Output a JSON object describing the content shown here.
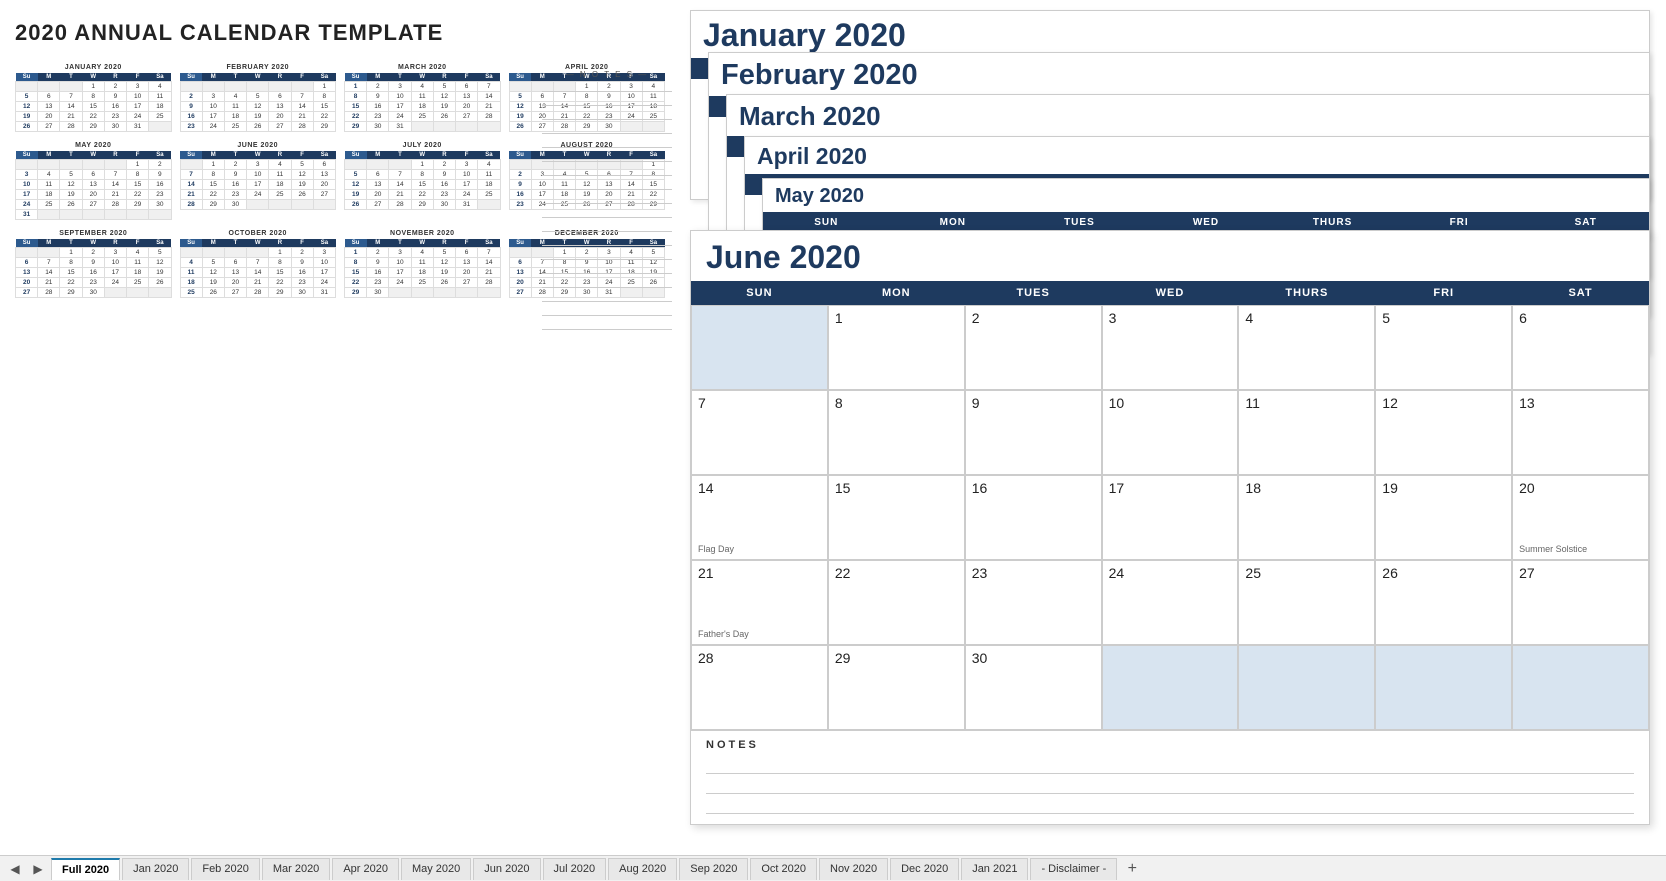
{
  "title": "2020 ANNUAL CALENDAR TEMPLATE",
  "annualCalendar": {
    "months": [
      {
        "name": "JANUARY 2020",
        "headers": [
          "Su",
          "M",
          "T",
          "W",
          "R",
          "F",
          "Sa"
        ],
        "weeks": [
          [
            "",
            "",
            "",
            "1",
            "2",
            "3",
            "4"
          ],
          [
            "5",
            "6",
            "7",
            "8",
            "9",
            "10",
            "11"
          ],
          [
            "12",
            "13",
            "14",
            "15",
            "16",
            "17",
            "18"
          ],
          [
            "19",
            "20",
            "21",
            "22",
            "23",
            "24",
            "25"
          ],
          [
            "26",
            "27",
            "28",
            "29",
            "30",
            "31",
            ""
          ]
        ]
      },
      {
        "name": "FEBRUARY 2020",
        "headers": [
          "Su",
          "M",
          "T",
          "W",
          "R",
          "F",
          "Sa"
        ],
        "weeks": [
          [
            "",
            "",
            "",
            "",
            "",
            "",
            "1"
          ],
          [
            "2",
            "3",
            "4",
            "5",
            "6",
            "7",
            "8"
          ],
          [
            "9",
            "10",
            "11",
            "12",
            "13",
            "14",
            "15"
          ],
          [
            "16",
            "17",
            "18",
            "19",
            "20",
            "21",
            "22"
          ],
          [
            "23",
            "24",
            "25",
            "26",
            "27",
            "28",
            "29"
          ]
        ]
      },
      {
        "name": "MARCH 2020",
        "headers": [
          "Su",
          "M",
          "T",
          "W",
          "R",
          "F",
          "Sa"
        ],
        "weeks": [
          [
            "1",
            "2",
            "3",
            "4",
            "5",
            "6",
            "7"
          ],
          [
            "8",
            "9",
            "10",
            "11",
            "12",
            "13",
            "14"
          ],
          [
            "15",
            "16",
            "17",
            "18",
            "19",
            "20",
            "21"
          ],
          [
            "22",
            "23",
            "24",
            "25",
            "26",
            "27",
            "28"
          ],
          [
            "29",
            "30",
            "31",
            "",
            "",
            "",
            ""
          ]
        ]
      },
      {
        "name": "APRIL 2020",
        "headers": [
          "Su",
          "M",
          "T",
          "W",
          "R",
          "F",
          "Sa"
        ],
        "weeks": [
          [
            "",
            "",
            "",
            "1",
            "2",
            "3",
            "4"
          ],
          [
            "5",
            "6",
            "7",
            "8",
            "9",
            "10",
            "11"
          ],
          [
            "12",
            "13",
            "14",
            "15",
            "16",
            "17",
            "18"
          ],
          [
            "19",
            "20",
            "21",
            "22",
            "23",
            "24",
            "25"
          ],
          [
            "26",
            "27",
            "28",
            "29",
            "30",
            "",
            ""
          ]
        ]
      },
      {
        "name": "MAY 2020",
        "headers": [
          "Su",
          "M",
          "T",
          "W",
          "R",
          "F",
          "Sa"
        ],
        "weeks": [
          [
            "",
            "",
            "",
            "",
            "",
            "1",
            "2"
          ],
          [
            "3",
            "4",
            "5",
            "6",
            "7",
            "8",
            "9"
          ],
          [
            "10",
            "11",
            "12",
            "13",
            "14",
            "15",
            "16"
          ],
          [
            "17",
            "18",
            "19",
            "20",
            "21",
            "22",
            "23"
          ],
          [
            "24",
            "25",
            "26",
            "27",
            "28",
            "29",
            "30"
          ],
          [
            "31",
            "",
            "",
            "",
            "",
            "",
            ""
          ]
        ]
      },
      {
        "name": "JUNE 2020",
        "headers": [
          "Su",
          "M",
          "T",
          "W",
          "R",
          "F",
          "Sa"
        ],
        "weeks": [
          [
            "",
            "1",
            "2",
            "3",
            "4",
            "5",
            "6"
          ],
          [
            "7",
            "8",
            "9",
            "10",
            "11",
            "12",
            "13"
          ],
          [
            "14",
            "15",
            "16",
            "17",
            "18",
            "19",
            "20"
          ],
          [
            "21",
            "22",
            "23",
            "24",
            "25",
            "26",
            "27"
          ],
          [
            "28",
            "29",
            "30",
            "",
            "",
            "",
            ""
          ]
        ]
      },
      {
        "name": "JULY 2020",
        "headers": [
          "Su",
          "M",
          "T",
          "W",
          "R",
          "F",
          "Sa"
        ],
        "weeks": [
          [
            "",
            "",
            "",
            "1",
            "2",
            "3",
            "4"
          ],
          [
            "5",
            "6",
            "7",
            "8",
            "9",
            "10",
            "11"
          ],
          [
            "12",
            "13",
            "14",
            "15",
            "16",
            "17",
            "18"
          ],
          [
            "19",
            "20",
            "21",
            "22",
            "23",
            "24",
            "25"
          ],
          [
            "26",
            "27",
            "28",
            "29",
            "30",
            "31",
            ""
          ]
        ]
      },
      {
        "name": "AUGUST 2020",
        "headers": [
          "Su",
          "M",
          "T",
          "W",
          "R",
          "F",
          "Sa"
        ],
        "weeks": [
          [
            "",
            "",
            "",
            "",
            "",
            "",
            "1"
          ],
          [
            "2",
            "3",
            "4",
            "5",
            "6",
            "7",
            "8"
          ],
          [
            "9",
            "10",
            "11",
            "12",
            "13",
            "14",
            "15"
          ],
          [
            "16",
            "17",
            "18",
            "19",
            "20",
            "21",
            "22"
          ],
          [
            "23",
            "24",
            "25",
            "26",
            "27",
            "28",
            "29"
          ]
        ]
      },
      {
        "name": "SEPTEMBER 2020",
        "headers": [
          "Su",
          "M",
          "T",
          "W",
          "R",
          "F",
          "Sa"
        ],
        "weeks": [
          [
            "",
            "",
            "1",
            "2",
            "3",
            "4",
            "5"
          ],
          [
            "6",
            "7",
            "8",
            "9",
            "10",
            "11",
            "12"
          ],
          [
            "13",
            "14",
            "15",
            "16",
            "17",
            "18",
            "19"
          ],
          [
            "20",
            "21",
            "22",
            "23",
            "24",
            "25",
            "26"
          ],
          [
            "27",
            "28",
            "29",
            "30",
            "",
            "",
            ""
          ]
        ]
      },
      {
        "name": "OCTOBER 2020",
        "headers": [
          "Su",
          "M",
          "T",
          "W",
          "R",
          "F",
          "Sa"
        ],
        "weeks": [
          [
            "",
            "",
            "",
            "",
            "1",
            "2",
            "3"
          ],
          [
            "4",
            "5",
            "6",
            "7",
            "8",
            "9",
            "10"
          ],
          [
            "11",
            "12",
            "13",
            "14",
            "15",
            "16",
            "17"
          ],
          [
            "18",
            "19",
            "20",
            "21",
            "22",
            "23",
            "24"
          ],
          [
            "25",
            "26",
            "27",
            "28",
            "29",
            "30",
            "31"
          ]
        ]
      },
      {
        "name": "NOVEMBER 2020",
        "headers": [
          "Su",
          "M",
          "T",
          "W",
          "R",
          "F",
          "Sa"
        ],
        "weeks": [
          [
            "1",
            "2",
            "3",
            "4",
            "5",
            "6",
            "7"
          ],
          [
            "8",
            "9",
            "10",
            "11",
            "12",
            "13",
            "14"
          ],
          [
            "15",
            "16",
            "17",
            "18",
            "19",
            "20",
            "21"
          ],
          [
            "22",
            "23",
            "24",
            "25",
            "26",
            "27",
            "28"
          ],
          [
            "29",
            "30",
            "",
            "",
            "",
            "",
            ""
          ]
        ]
      },
      {
        "name": "DECEMBER 2020",
        "headers": [
          "Su",
          "M",
          "T",
          "W",
          "R",
          "F",
          "Sa"
        ],
        "weeks": [
          [
            "",
            "",
            "1",
            "2",
            "3",
            "4",
            "5"
          ],
          [
            "6",
            "7",
            "8",
            "9",
            "10",
            "11",
            "12"
          ],
          [
            "13",
            "14",
            "15",
            "16",
            "17",
            "18",
            "19"
          ],
          [
            "20",
            "21",
            "22",
            "23",
            "24",
            "25",
            "26"
          ],
          [
            "27",
            "28",
            "29",
            "30",
            "31",
            "",
            ""
          ]
        ]
      }
    ]
  },
  "stackedMonths": [
    {
      "name": "January 2020"
    },
    {
      "name": "February 2020"
    },
    {
      "name": "March 2020"
    },
    {
      "name": "April 2020"
    },
    {
      "name": "May 2020"
    }
  ],
  "june2020": {
    "title": "June 2020",
    "headers": [
      "SUN",
      "MON",
      "TUES",
      "WED",
      "THURS",
      "FRI",
      "SAT"
    ],
    "weeks": [
      [
        {
          "day": "",
          "empty": true
        },
        {
          "day": "1"
        },
        {
          "day": "2"
        },
        {
          "day": "3"
        },
        {
          "day": "4"
        },
        {
          "day": "5"
        },
        {
          "day": "6"
        }
      ],
      [
        {
          "day": "7"
        },
        {
          "day": "8"
        },
        {
          "day": "9"
        },
        {
          "day": "10"
        },
        {
          "day": "11"
        },
        {
          "day": "12"
        },
        {
          "day": "13"
        }
      ],
      [
        {
          "day": "14",
          "event": "Flag Day"
        },
        {
          "day": "15"
        },
        {
          "day": "16"
        },
        {
          "day": "17"
        },
        {
          "day": "18"
        },
        {
          "day": "19"
        },
        {
          "day": "20",
          "event": "Summer Solstice"
        }
      ],
      [
        {
          "day": "21",
          "event": "Father's Day"
        },
        {
          "day": "22"
        },
        {
          "day": "23"
        },
        {
          "day": "24"
        },
        {
          "day": "25"
        },
        {
          "day": "26"
        },
        {
          "day": "27"
        }
      ],
      [
        {
          "day": "28"
        },
        {
          "day": "29"
        },
        {
          "day": "30"
        },
        {
          "day": "",
          "empty": true
        },
        {
          "day": "",
          "empty": true
        },
        {
          "day": "",
          "empty": true
        },
        {
          "day": "",
          "empty": true
        }
      ]
    ],
    "notes": "NOTES"
  },
  "notes": {
    "title": "— N O T E S —",
    "lines": 18
  },
  "tabs": {
    "items": [
      {
        "label": "Full 2020",
        "active": true
      },
      {
        "label": "Jan 2020",
        "active": false
      },
      {
        "label": "Feb 2020",
        "active": false
      },
      {
        "label": "Mar 2020",
        "active": false
      },
      {
        "label": "Apr 2020",
        "active": false
      },
      {
        "label": "May 2020",
        "active": false
      },
      {
        "label": "Jun 2020",
        "active": false
      },
      {
        "label": "Jul 2020",
        "active": false
      },
      {
        "label": "Aug 2020",
        "active": false
      },
      {
        "label": "Sep 2020",
        "active": false
      },
      {
        "label": "Oct 2020",
        "active": false
      },
      {
        "label": "Nov 2020",
        "active": false
      },
      {
        "label": "Dec 2020",
        "active": false
      },
      {
        "label": "Jan 2021",
        "active": false
      },
      {
        "label": "- Disclaimer -",
        "active": false
      }
    ]
  }
}
